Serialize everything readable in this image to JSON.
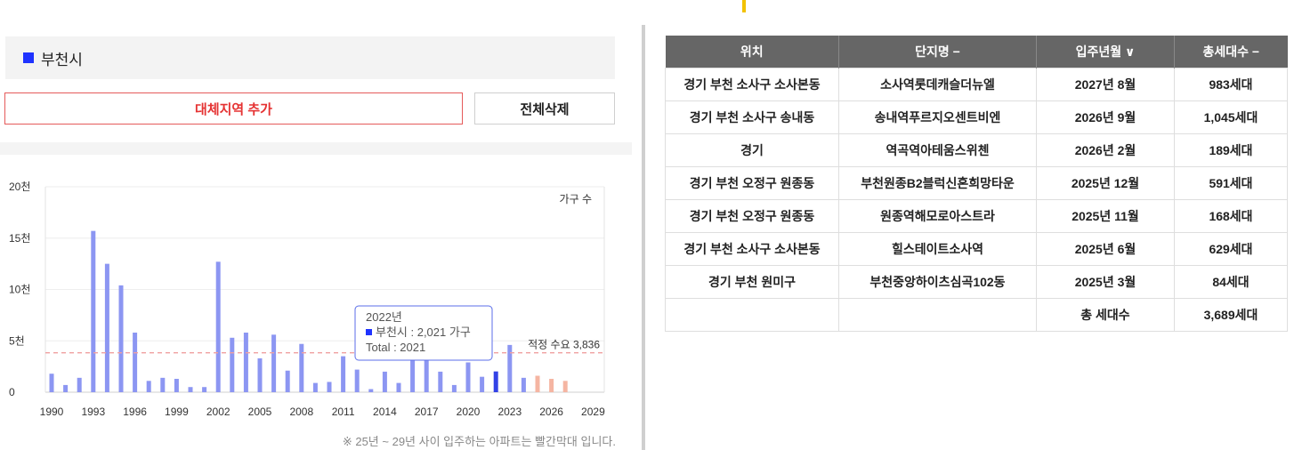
{
  "region": {
    "name": "부천시",
    "color": "#1f33ff"
  },
  "buttons": {
    "add_label": "대체지역 추가",
    "delete_all_label": "전체삭제"
  },
  "chart_data": {
    "type": "bar",
    "series_name": "가구 수",
    "y_ticks": [
      "0",
      "5천",
      "10천",
      "15천",
      "20천"
    ],
    "ylim": [
      0,
      20000
    ],
    "x_tick_labels": [
      "1990",
      "1993",
      "1996",
      "1999",
      "2002",
      "2005",
      "2008",
      "2011",
      "2014",
      "2017",
      "2020",
      "2023",
      "2026",
      "2029"
    ],
    "categories": [
      1990,
      1991,
      1992,
      1993,
      1994,
      1995,
      1996,
      1997,
      1998,
      1999,
      2000,
      2001,
      2002,
      2003,
      2004,
      2005,
      2006,
      2007,
      2008,
      2009,
      2010,
      2011,
      2012,
      2013,
      2014,
      2015,
      2016,
      2017,
      2018,
      2019,
      2020,
      2021,
      2022,
      2023,
      2024,
      2025,
      2026,
      2027
    ],
    "values": [
      1800,
      700,
      1400,
      15700,
      12500,
      10400,
      5800,
      1100,
      1400,
      1300,
      500,
      500,
      12700,
      5300,
      5800,
      3300,
      5600,
      2100,
      4700,
      900,
      1000,
      3500,
      2200,
      300,
      2000,
      900,
      3500,
      3300,
      2000,
      700,
      2900,
      1500,
      2021,
      4600,
      1400,
      1600,
      1300,
      1100
    ],
    "highlight_category": 2022,
    "future_from": 2025,
    "colors": {
      "normal": "#8c96f2",
      "highlight": "#3342e6",
      "future": "#f5b5a2",
      "reference": "#f0a0a0"
    },
    "reference": {
      "value": 3836,
      "label": "적정 수요 3,836"
    },
    "tooltip": {
      "title": "2022년",
      "line1": "부천시 : 2,021 가구",
      "line2": "Total : 2021"
    },
    "grid": true
  },
  "note": "※ 25년 ~ 29년 사이 입주하는 아파트는 빨간막대 입니다.",
  "table": {
    "headers": [
      "위치",
      "단지명 −",
      "입주년월 ∨",
      "총세대수 −"
    ],
    "rows": [
      [
        "경기 부천 소사구 소사본동",
        "소사역롯데캐슬더뉴엘",
        "2027년 8월",
        "983세대"
      ],
      [
        "경기 부천 소사구 송내동",
        "송내역푸르지오센트비엔",
        "2026년 9월",
        "1,045세대"
      ],
      [
        "경기",
        "역곡역아테움스위첸",
        "2026년 2월",
        "189세대"
      ],
      [
        "경기 부천 오정구 원종동",
        "부천원종B2블럭신혼희망타운",
        "2025년 12월",
        "591세대"
      ],
      [
        "경기 부천 오정구 원종동",
        "원종역해모로아스트라",
        "2025년 11월",
        "168세대"
      ],
      [
        "경기 부천 소사구 소사본동",
        "힐스테이트소사역",
        "2025년 6월",
        "629세대"
      ],
      [
        "경기 부천 원미구",
        "부천중앙하이츠심곡102동",
        "2025년 3월",
        "84세대"
      ]
    ],
    "total_label": "총 세대수",
    "total_value": "3,689세대"
  }
}
